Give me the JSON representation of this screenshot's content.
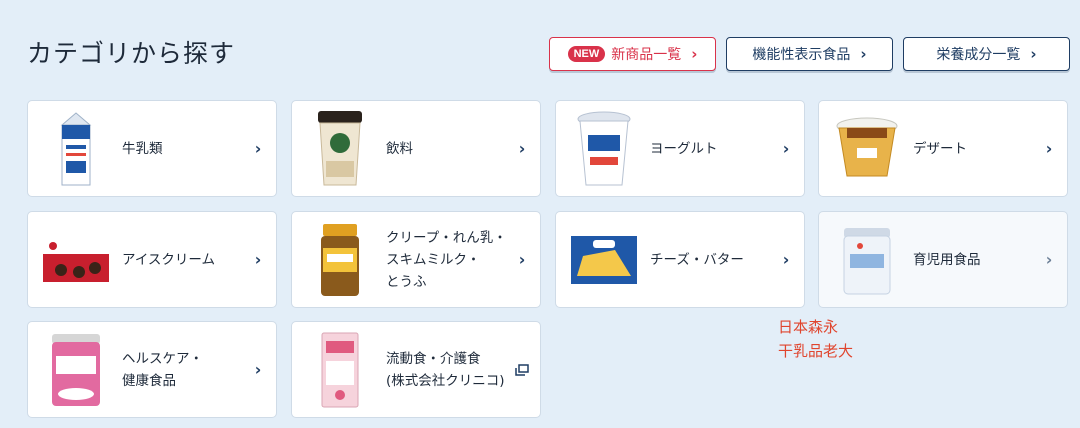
{
  "section_title": "カテゴリから探す",
  "top_buttons": {
    "new_badge": "NEW",
    "new_products": "新商品一覧",
    "functional": "機能性表示食品",
    "nutrition": "栄養成分一覧"
  },
  "categories": [
    {
      "label": "牛乳類"
    },
    {
      "label": "飲料"
    },
    {
      "label": "ヨーグルト"
    },
    {
      "label": "デザート"
    },
    {
      "label": "アイスクリーム"
    },
    {
      "label": "クリープ・れん乳・\nスキムミルク・\nとうふ"
    },
    {
      "label": "チーズ・バター"
    },
    {
      "label": "育児用食品"
    },
    {
      "label": "ヘルスケア・\n健康食品"
    },
    {
      "label": "流動食・介護食\n(株式会社クリニコ)"
    }
  ],
  "chevron": "›",
  "annotation": "日本森永\n干乳品老大",
  "colors": {
    "accent": "#1f3d63",
    "new": "#d9324a",
    "background": "#e3eef8",
    "annotation": "#e0452e"
  }
}
